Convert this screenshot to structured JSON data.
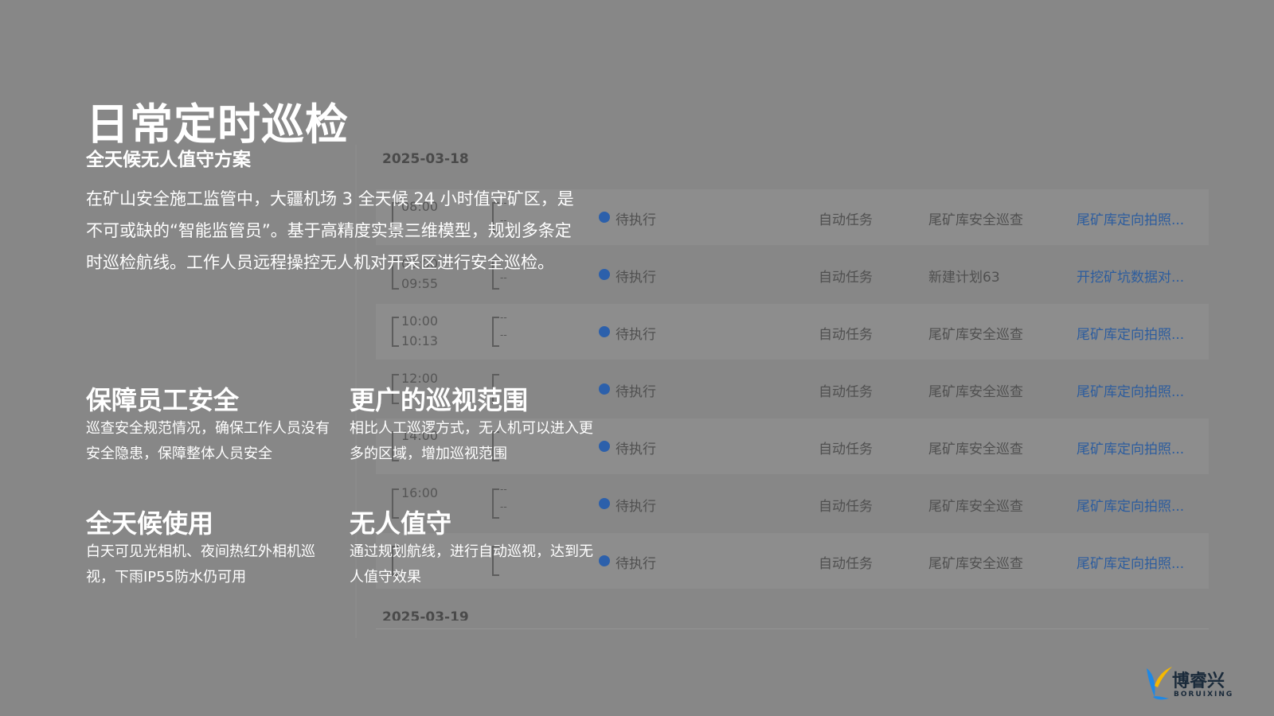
{
  "slide": {
    "title": "日常定时巡检",
    "subtitle": "全天候无人值守方案",
    "intro": "在矿山安全施工监管中，大疆机场 3 全天候 24 小时值守矿区，是不可或缺的“智能监管员”。基于高精度实景三维模型，规划多条定时巡检航线。工作人员远程操控无人机对开采区进行安全巡检。",
    "features": [
      {
        "title": "保障员工安全",
        "desc": "巡查安全规范情况，确保工作人员没有安全隐患，保障整体人员安全"
      },
      {
        "title": "更广的巡视范围",
        "desc": "相比人工巡逻方式，无人机可以进入更多的区域，增加巡视范围"
      },
      {
        "title": "全天候使用",
        "desc": "白天可见光相机、夜间热红外相机巡视，下雨IP55防水仍可用"
      },
      {
        "title": "无人值守",
        "desc": "通过规划航线，进行自动巡视，达到无人值守效果"
      }
    ]
  },
  "schedule": {
    "date_top": "2025-03-18",
    "date_bottom": "2025-03-19",
    "rows": [
      {
        "start": "08:00",
        "end": "",
        "dash_a": "--",
        "dash_b": "--",
        "status": "待执行",
        "type": "自动任务",
        "plan": "尾矿库安全巡查",
        "route": "尾矿库定向拍照..."
      },
      {
        "start": "09:00",
        "end": "09:55",
        "dash_a": "",
        "dash_b": "--",
        "status": "待执行",
        "type": "自动任务",
        "plan": "新建计划63",
        "route": "开挖矿坑数据对..."
      },
      {
        "start": "10:00",
        "end": "10:13",
        "dash_a": "--",
        "dash_b": "--",
        "status": "待执行",
        "type": "自动任务",
        "plan": "尾矿库安全巡查",
        "route": "尾矿库定向拍照..."
      },
      {
        "start": "12:00",
        "end": "",
        "dash_a": "",
        "dash_b": "",
        "status": "待执行",
        "type": "自动任务",
        "plan": "尾矿库安全巡查",
        "route": "尾矿库定向拍照..."
      },
      {
        "start": "14:00",
        "end": "",
        "dash_a": "",
        "dash_b": "",
        "status": "待执行",
        "type": "自动任务",
        "plan": "尾矿库安全巡查",
        "route": "尾矿库定向拍照..."
      },
      {
        "start": "16:00",
        "end": "",
        "dash_a": "--",
        "dash_b": "--",
        "status": "待执行",
        "type": "自动任务",
        "plan": "尾矿库安全巡查",
        "route": "尾矿库定向拍照..."
      },
      {
        "start": "",
        "end": "",
        "dash_a": "",
        "dash_b": "",
        "status": "待执行",
        "type": "自动任务",
        "plan": "尾矿库安全巡查",
        "route": "尾矿库定向拍照..."
      }
    ]
  },
  "brand": {
    "name_cn": "博睿兴",
    "name_en": "BORUIXING",
    "accent_blue": "#1e88e5",
    "accent_yellow": "#f5b800"
  }
}
